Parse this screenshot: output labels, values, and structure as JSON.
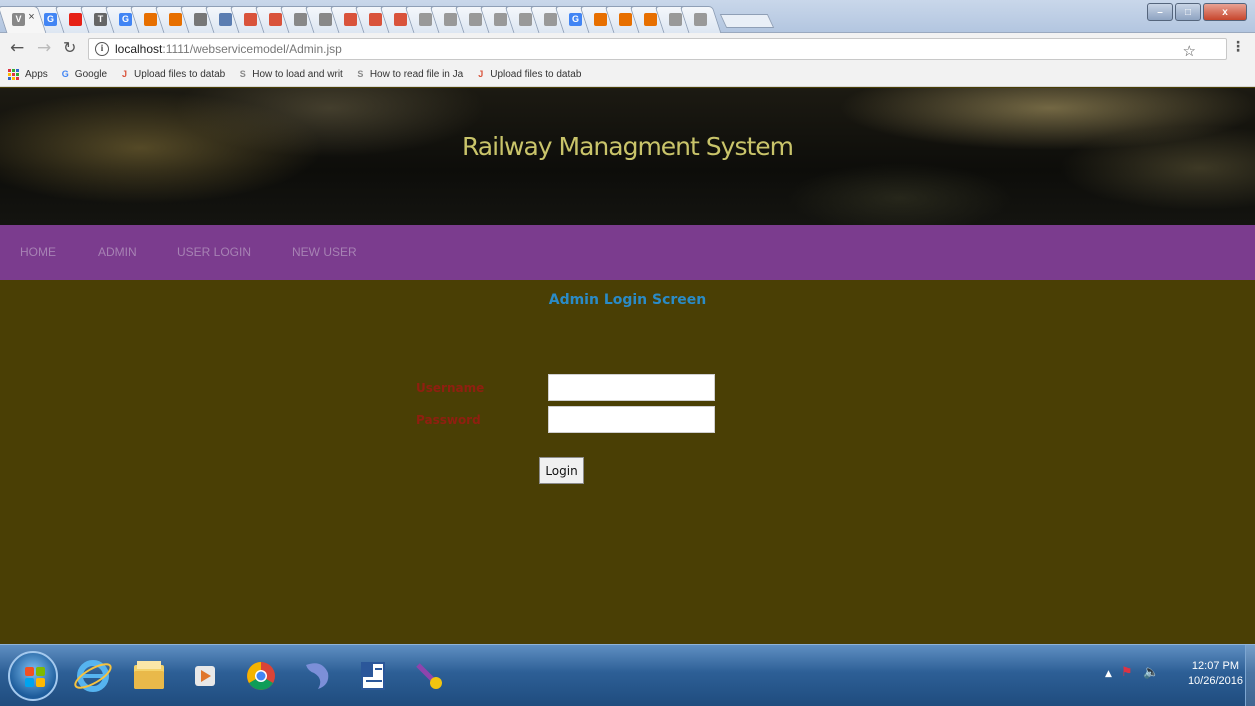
{
  "browser": {
    "tabs": [
      {
        "icon": "document-icon",
        "label": "V",
        "color": "#888888"
      },
      {
        "icon": "google-icon",
        "label": "G",
        "color": "#4285f4"
      },
      {
        "icon": "youtube-icon",
        "label": "",
        "color": "#e62117"
      },
      {
        "icon": "translate-icon",
        "label": "T",
        "color": "#666666"
      },
      {
        "icon": "google-icon",
        "label": "G",
        "color": "#4285f4"
      },
      {
        "icon": "java-icon",
        "label": "",
        "color": "#e76f00"
      },
      {
        "icon": "java-icon",
        "label": "",
        "color": "#e76f00"
      },
      {
        "icon": "clock-icon",
        "label": "",
        "color": "#777777"
      },
      {
        "icon": "globe-icon",
        "label": "",
        "color": "#5b7db1"
      },
      {
        "icon": "javatpoint-icon",
        "label": "",
        "color": "#d9533b"
      },
      {
        "icon": "javatpoint-icon",
        "label": "",
        "color": "#d9533b"
      },
      {
        "icon": "stackoverflow-icon",
        "label": "",
        "color": "#888888"
      },
      {
        "icon": "stackoverflow-icon",
        "label": "",
        "color": "#888888"
      },
      {
        "icon": "javatpoint-icon",
        "label": "",
        "color": "#d9533b"
      },
      {
        "icon": "javatpoint-icon",
        "label": "",
        "color": "#d9533b"
      },
      {
        "icon": "javatpoint-icon",
        "label": "",
        "color": "#d9533b"
      },
      {
        "icon": "page-icon",
        "label": "",
        "color": "#999999"
      },
      {
        "icon": "page-icon",
        "label": "",
        "color": "#999999"
      },
      {
        "icon": "page-icon",
        "label": "",
        "color": "#999999"
      },
      {
        "icon": "page-icon",
        "label": "",
        "color": "#999999"
      },
      {
        "icon": "page-icon",
        "label": "",
        "color": "#999999"
      },
      {
        "icon": "page-icon",
        "label": "",
        "color": "#999999"
      },
      {
        "icon": "google-icon",
        "label": "G",
        "color": "#4285f4"
      },
      {
        "icon": "java-icon",
        "label": "",
        "color": "#e76f00"
      },
      {
        "icon": "java-icon",
        "label": "",
        "color": "#e76f00"
      },
      {
        "icon": "java-icon",
        "label": "",
        "color": "#e76f00"
      },
      {
        "icon": "page-icon",
        "label": "",
        "color": "#999999"
      },
      {
        "icon": "page-icon",
        "label": "",
        "color": "#999999"
      }
    ],
    "active_tab_close": "×",
    "window_buttons": {
      "minimize": "–",
      "maximize": "□",
      "close": "x"
    },
    "address": {
      "host": "localhost",
      "rest": ":1111/webservicemodel/Admin.jsp"
    },
    "bookmarks": [
      {
        "label": "Apps",
        "icon": "apps-icon"
      },
      {
        "label": "Google",
        "icon": "google-icon",
        "icon_text": "G",
        "color": "#4285f4"
      },
      {
        "label": "Upload files to datab",
        "icon": "javatpoint-icon",
        "icon_text": "J",
        "color": "#d9533b"
      },
      {
        "label": "How to load and writ",
        "icon": "stackoverflow-icon",
        "icon_text": "S",
        "color": "#888888"
      },
      {
        "label": "How to read file in Ja",
        "icon": "stackoverflow-icon",
        "icon_text": "S",
        "color": "#888888"
      },
      {
        "label": "Upload files to datab",
        "icon": "javatpoint-icon",
        "icon_text": "J",
        "color": "#d9533b"
      }
    ]
  },
  "page": {
    "title": "Railway Managment System",
    "menu": [
      "HOME",
      "ADMIN",
      "USER LOGIN",
      "NEW USER"
    ],
    "login": {
      "heading": "Admin Login Screen",
      "username_label": "Username",
      "password_label": "Password",
      "username_value": "",
      "password_value": "",
      "button_label": "Login"
    },
    "colors": {
      "banner_title": "#c9c46a",
      "menu_bar": "#7b3c8e",
      "content_bg": "#4a3f05",
      "heading": "#2a8bc7",
      "field_label": "#8f1f10"
    }
  },
  "taskbar": {
    "apps": [
      "start-orb-icon",
      "internet-explorer-icon",
      "file-explorer-icon",
      "media-player-icon",
      "chrome-icon",
      "eclipse-icon",
      "word-icon",
      "netbeans-icon"
    ],
    "time": "12:07 PM",
    "date": "10/26/2016"
  }
}
